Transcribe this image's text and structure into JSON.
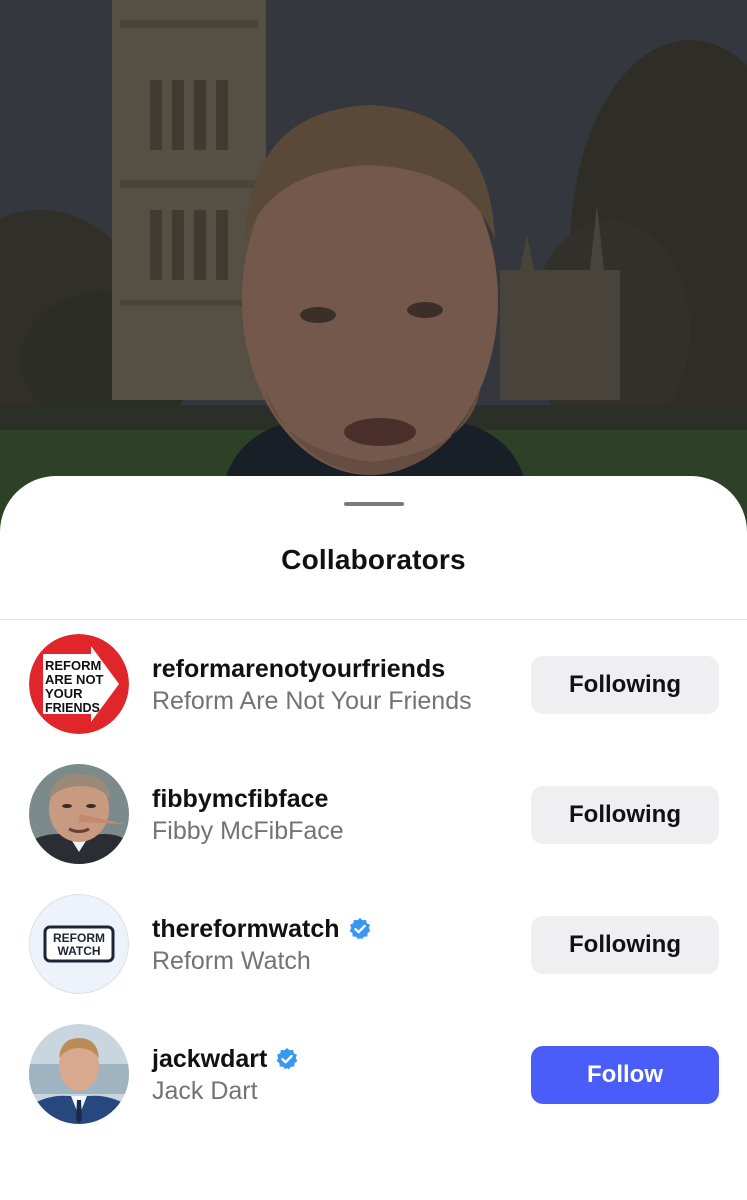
{
  "sheet": {
    "title": "Collaborators"
  },
  "collaborators": [
    {
      "username": "reformarenotyourfriends",
      "full_name": "Reform Are Not Your Friends",
      "verified": false,
      "button_label": "Following",
      "avatar": {
        "icon": "reform-are-not-your-friends-logo",
        "text_lines": [
          "REFORM",
          "ARE NOT",
          "YOUR",
          "FRIENDS"
        ]
      }
    },
    {
      "username": "fibbymcfibface",
      "full_name": "Fibby McFibFace",
      "verified": false,
      "button_label": "Following",
      "avatar": {
        "icon": "caricature-portrait"
      }
    },
    {
      "username": "thereformwatch",
      "full_name": "Reform Watch",
      "verified": true,
      "button_label": "Following",
      "avatar": {
        "icon": "reform-watch-logo",
        "text_lines": [
          "REFORM",
          "WATCH"
        ]
      }
    },
    {
      "username": "jackwdart",
      "full_name": "Jack Dart",
      "verified": true,
      "button_label": "Follow",
      "avatar": {
        "icon": "person-portrait"
      }
    }
  ],
  "colors": {
    "follow_button": "#4a5df9",
    "following_button": "#efeff2",
    "verified_badge": "#3897f0",
    "secondary_text": "#737373",
    "logo_red": "#e0262b"
  }
}
